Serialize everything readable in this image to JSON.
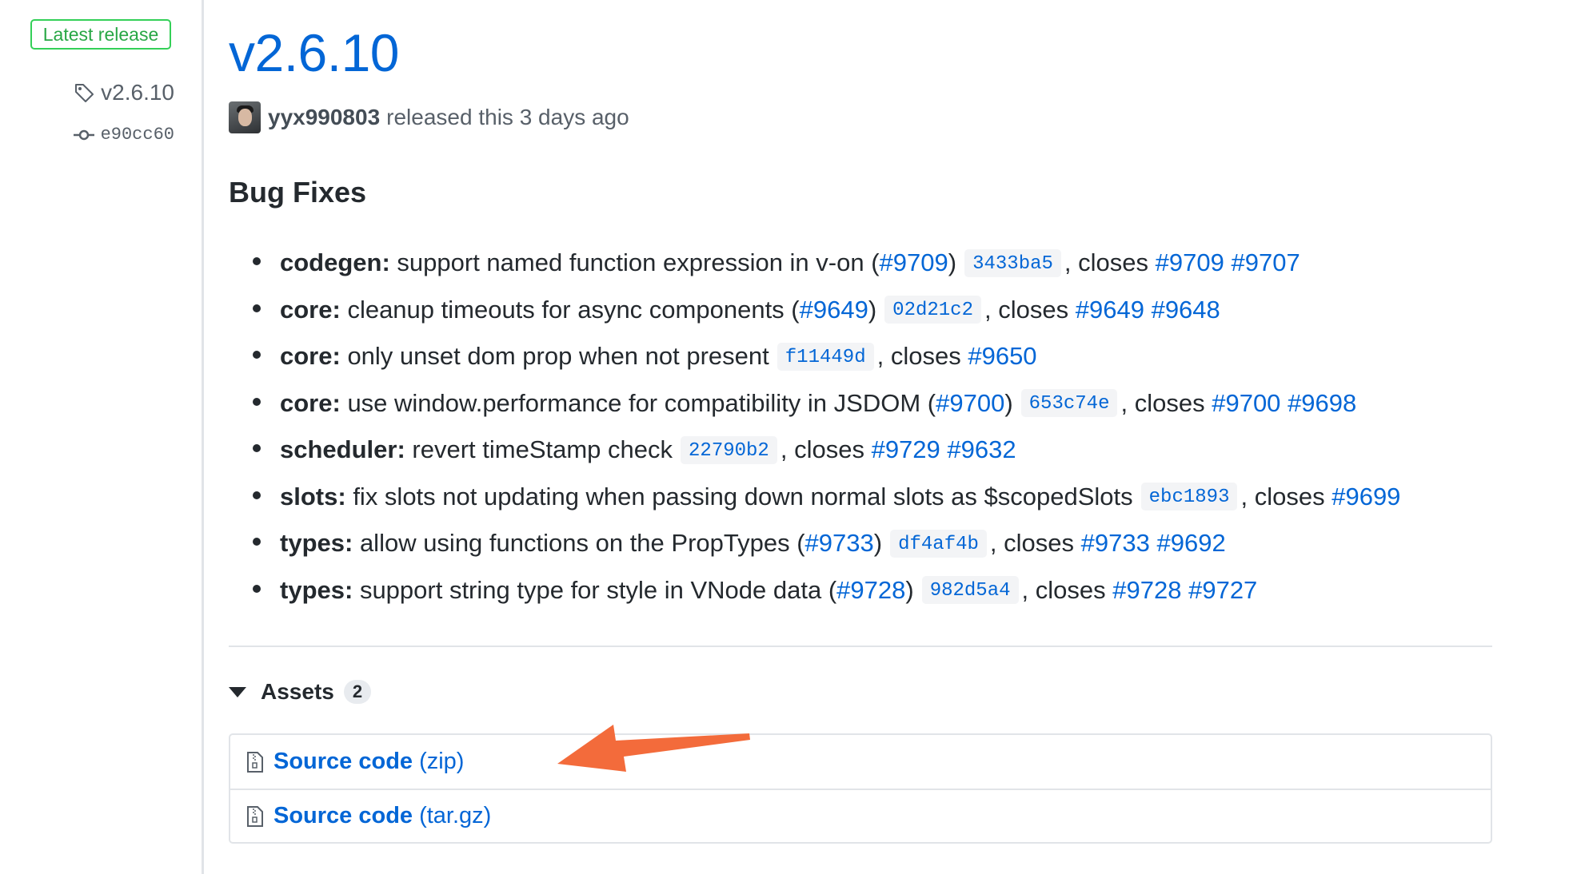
{
  "sidebar": {
    "badge": "Latest release",
    "tag": "v2.6.10",
    "commit": "e90cc60"
  },
  "release": {
    "title": "v2.6.10",
    "author": "yyx990803",
    "released_text": "released this 3 days ago"
  },
  "section_title": "Bug Fixes",
  "bug_fixes": [
    {
      "scope": "codegen:",
      "desc": "support named function expression in v-on",
      "pr": "#9709",
      "sha": "3433ba5",
      "closes_label": ", closes",
      "issues": [
        "#9709",
        "#9707"
      ]
    },
    {
      "scope": "core:",
      "desc": "cleanup timeouts for async components",
      "pr": "#9649",
      "sha": "02d21c2",
      "closes_label": ", closes",
      "issues": [
        "#9649",
        "#9648"
      ]
    },
    {
      "scope": "core:",
      "desc": "only unset dom prop when not present",
      "pr": "",
      "sha": "f11449d",
      "closes_label": ", closes",
      "issues": [
        "#9650"
      ]
    },
    {
      "scope": "core:",
      "desc": "use window.performance for compatibility in JSDOM",
      "pr": "#9700",
      "sha": "653c74e",
      "closes_label": ", closes",
      "issues": [
        "#9700",
        "#9698"
      ]
    },
    {
      "scope": "scheduler:",
      "desc": "revert timeStamp check",
      "pr": "",
      "sha": "22790b2",
      "closes_label": ", closes",
      "issues": [
        "#9729",
        "#9632"
      ]
    },
    {
      "scope": "slots:",
      "desc": "fix slots not updating when passing down normal slots as $scopedSlots",
      "pr": "",
      "sha": "ebc1893",
      "closes_label": ", closes",
      "issues": [
        "#9699"
      ]
    },
    {
      "scope": "types:",
      "desc": "allow using functions on the PropTypes",
      "pr": "#9733",
      "sha": "df4af4b",
      "closes_label": ", closes",
      "issues": [
        "#9733",
        "#9692"
      ]
    },
    {
      "scope": "types:",
      "desc": "support string type for style in VNode data",
      "pr": "#9728",
      "sha": "982d5a4",
      "closes_label": ", closes",
      "issues": [
        "#9728",
        "#9727"
      ]
    }
  ],
  "assets": {
    "label": "Assets",
    "count": "2",
    "items": [
      {
        "name": "Source code",
        "ext": "(zip)"
      },
      {
        "name": "Source code",
        "ext": "(tar.gz)"
      }
    ]
  },
  "colors": {
    "link": "#0366d6",
    "badge": "#28a745",
    "arrow": "#f36b3b"
  }
}
